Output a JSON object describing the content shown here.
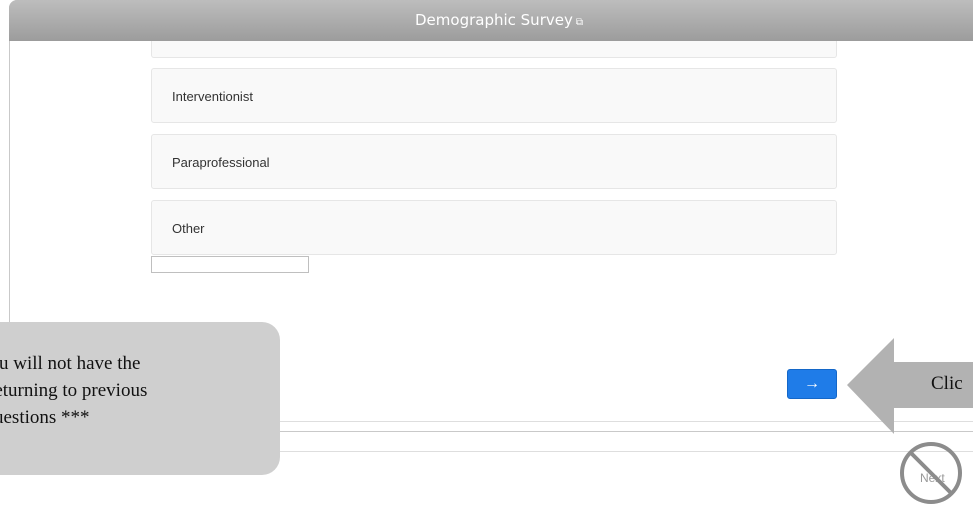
{
  "window": {
    "title": "Demographic Survey",
    "title_icon": "external-link-icon"
  },
  "options": [
    {
      "label": "Interventionist"
    },
    {
      "label": "Paraprofessional"
    },
    {
      "label": "Other"
    }
  ],
  "other_input": {
    "value": ""
  },
  "next_button": {
    "label": "→",
    "color": "#1f7ce8"
  },
  "callout": {
    "lines": [
      "u will not have the",
      "returning to previous",
      "uestions ***"
    ]
  },
  "pointer_label": "Clic",
  "disabled_next": {
    "label": "Next",
    "icon": "no-entry-icon"
  }
}
